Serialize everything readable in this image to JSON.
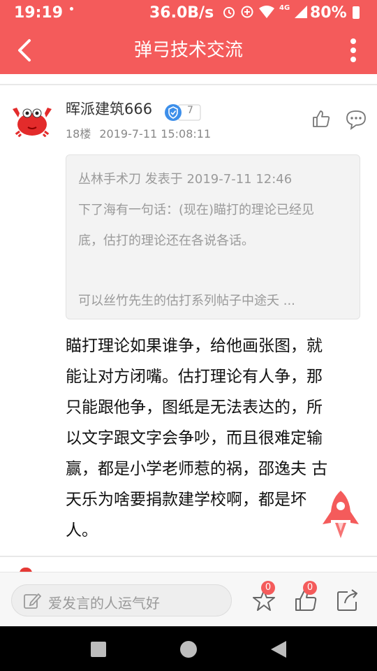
{
  "status_bar": {
    "time": "19:19",
    "dot": "•",
    "net_speed": "36.0B/s",
    "network": "4G",
    "battery": "80%"
  },
  "nav": {
    "title": "弹弓技术交流"
  },
  "post": {
    "user_name": "晖派建筑666",
    "level": "7",
    "floor": "18楼",
    "time": "2019-7-11 15:08:11",
    "quote": {
      "header": "丛林手术刀 发表于 2019-7-11 12:46",
      "line1": "下了海有一句话：(现在)瞄打的理论已经见",
      "line2": "底，估打的理论还在各说各话。",
      "line3": "可以丝竹先生的估打系列帖子中途夭 ..."
    },
    "body_lines": [
      "瞄打理论如果谁争，给他画张图，就",
      "能让对方闭嘴。估打理论有人争，那",
      "只能跟他争，图纸是无法表达的，所",
      "以文字跟文字会争吵，而且很难定输",
      "赢，都是小学老师惹的祸，邵逸夫 古",
      "天乐为啥要捐款建学校啊，都是坏",
      "人。"
    ]
  },
  "bottom_bar": {
    "placeholder": "爱发言的人运气好",
    "favorite_count": "0",
    "like_count": "0"
  },
  "colors": {
    "brand": "#f45b5b",
    "verify": "#3d8fea"
  }
}
